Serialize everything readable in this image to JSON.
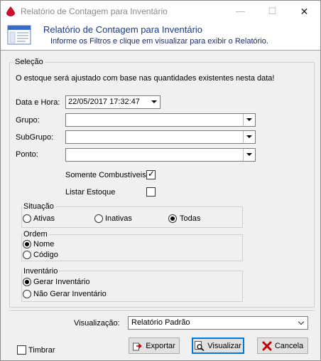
{
  "window": {
    "title": "Relatório de Contagem para Inventário",
    "controls": {
      "minimize": "—",
      "maximize": "☐",
      "close": "✕"
    }
  },
  "header": {
    "title": "Relatório de Contagem para Inventário",
    "subtitle": "Informe os Filtros e clique em visualizar para exibir o Relatório."
  },
  "selection": {
    "legend": "Seleção",
    "info": "O estoque será ajustado com base nas quantidades existentes  nesta data!",
    "datetime_label": "Data e Hora:",
    "datetime_value": "22/05/2017 17:32:47",
    "grupo_label": "Grupo:",
    "grupo_value": "",
    "subgrupo_label": "SubGrupo:",
    "subgrupo_value": "",
    "ponto_label": "Ponto:",
    "ponto_value": "",
    "somente_combustiveis": {
      "label": "Somente Combustíveis",
      "checked": true
    },
    "listar_estoque": {
      "label": "Listar Estoque",
      "checked": false
    }
  },
  "situacao": {
    "legend": "Situação",
    "options": [
      {
        "label": "Ativas",
        "selected": false
      },
      {
        "label": "Inativas",
        "selected": false
      },
      {
        "label": "Todas",
        "selected": true
      }
    ]
  },
  "ordem": {
    "legend": "Ordem",
    "options": [
      {
        "label": "Nome",
        "selected": true
      },
      {
        "label": "Código",
        "selected": false
      }
    ]
  },
  "inventario": {
    "legend": "Inventário",
    "options": [
      {
        "label": "Gerar Inventário",
        "selected": true
      },
      {
        "label": "Não Gerar Inventário",
        "selected": false
      }
    ]
  },
  "footer": {
    "visualizacao_label": "Visualização:",
    "visualizacao_value": "Relatório Padrão",
    "timbrar": {
      "label": "Timbrar",
      "checked": false
    },
    "exportar_label": "Exportar",
    "visualizar_label": "Visualizar",
    "cancela_label": "Cancela"
  },
  "colors": {
    "header_title": "#1a3a8a",
    "focus_border": "#0078d7",
    "cancel_x": "#c00000"
  }
}
